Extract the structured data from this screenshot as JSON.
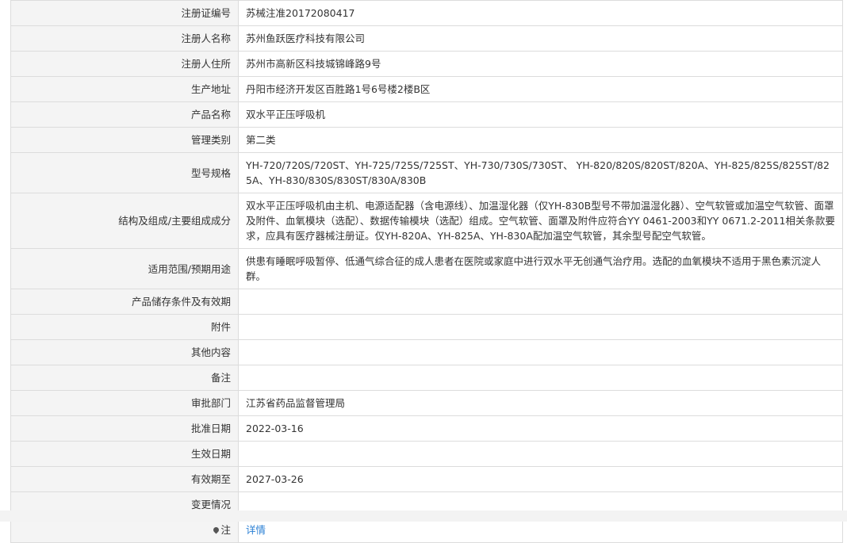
{
  "rows": [
    {
      "label": "注册证编号",
      "value": "苏械注准20172080417"
    },
    {
      "label": "注册人名称",
      "value": "苏州鱼跃医疗科技有限公司"
    },
    {
      "label": "注册人住所",
      "value": "苏州市高新区科技城锦峰路9号"
    },
    {
      "label": "生产地址",
      "value": "丹阳市经济开发区百胜路1号6号楼2楼B区"
    },
    {
      "label": "产品名称",
      "value": "双水平正压呼吸机"
    },
    {
      "label": "管理类别",
      "value": "第二类"
    },
    {
      "label": "型号规格",
      "value": "YH-720/720S/720ST、YH-725/725S/725ST、YH-730/730S/730ST、 YH-820/820S/820ST/820A、YH-825/825S/825ST/825A、YH-830/830S/830ST/830A/830B"
    },
    {
      "label": "结构及组成/主要组成成分",
      "value": "双水平正压呼吸机由主机、电源适配器（含电源线）、加温湿化器（仅YH-830B型号不带加温湿化器）、空气软管或加温空气软管、面罩及附件、血氧模块（选配）、数据传输模块（选配）组成。空气软管、面罩及附件应符合YY 0461-2003和YY 0671.2-2011相关条款要求，应具有医疗器械注册证。仅YH-820A、YH-825A、YH-830A配加温空气软管，其余型号配空气软管。"
    },
    {
      "label": "适用范围/预期用途",
      "value": "供患有睡眠呼吸暂停、低通气综合征的成人患者在医院或家庭中进行双水平无创通气治疗用。选配的血氧模块不适用于黑色素沉淀人群。"
    },
    {
      "label": "产品储存条件及有效期",
      "value": ""
    },
    {
      "label": "附件",
      "value": ""
    },
    {
      "label": "其他内容",
      "value": ""
    },
    {
      "label": "备注",
      "value": ""
    },
    {
      "label": "审批部门",
      "value": "江苏省药品监督管理局"
    },
    {
      "label": "批准日期",
      "value": "2022-03-16"
    },
    {
      "label": "生效日期",
      "value": ""
    },
    {
      "label": "有效期至",
      "value": "2027-03-26"
    },
    {
      "label": "变更情况",
      "value": ""
    }
  ],
  "note": {
    "label": "注",
    "icon": "pin-icon",
    "link_text": "详情"
  }
}
